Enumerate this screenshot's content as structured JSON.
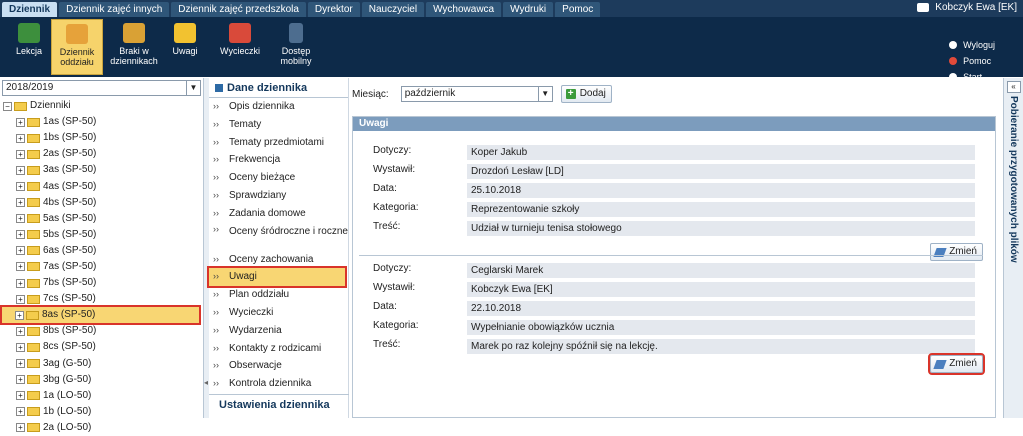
{
  "topbar": {
    "tabs": [
      "Dziennik",
      "Dziennik zajęć innych",
      "Dziennik zajęć przedszkola",
      "Dyrektor",
      "Nauczyciel",
      "Wychowawca",
      "Wydruki",
      "Pomoc"
    ],
    "user": "Kobczyk Ewa [EK]"
  },
  "toolbar": {
    "items": [
      {
        "label": "Lekcja",
        "icon": "chalkboard-icon"
      },
      {
        "label": "Dziennik oddziału",
        "icon": "journal-icon"
      },
      {
        "label": "Braki w dziennikach",
        "icon": "missing-book-icon"
      },
      {
        "label": "Uwagi",
        "icon": "warning-icon"
      },
      {
        "label": "Wycieczki",
        "icon": "backpack-icon"
      },
      {
        "label": "Dostęp mobilny",
        "icon": "mobile-icon"
      }
    ],
    "links": [
      "Wyloguj",
      "Pomoc",
      "Start"
    ]
  },
  "left": {
    "year": "2018/2019",
    "root": "Dzienniki",
    "classes": [
      "1as (SP-50)",
      "1bs (SP-50)",
      "2as (SP-50)",
      "3as (SP-50)",
      "4as (SP-50)",
      "4bs (SP-50)",
      "5as (SP-50)",
      "5bs (SP-50)",
      "6as (SP-50)",
      "7as (SP-50)",
      "7bs (SP-50)",
      "7cs (SP-50)",
      "8as (SP-50)",
      "8bs (SP-50)",
      "8cs (SP-50)",
      "3ag (G-50)",
      "3bg (G-50)",
      "1a (LO-50)",
      "1b (LO-50)",
      "2a (LO-50)"
    ],
    "selected_index": 12
  },
  "menu": {
    "header": "Dane dziennika",
    "items": [
      "Opis dziennika",
      "Tematy",
      "Tematy przedmiotami",
      "Frekwencja",
      "Oceny bieżące",
      "Sprawdziany",
      "Zadania domowe",
      "Oceny śródroczne i roczne",
      "Oceny zachowania",
      "Uwagi",
      "Plan oddziału",
      "Wycieczki",
      "Wydarzenia",
      "Kontakty z rodzicami",
      "Obserwacje",
      "Kontrola dziennika"
    ],
    "selected_index": 9,
    "footer": "Ustawienia dziennika"
  },
  "content": {
    "month_label": "Miesiąc:",
    "month_value": "październik",
    "add_label": "Dodaj",
    "panel_title": "Uwagi",
    "field_labels": [
      "Dotyczy:",
      "Wystawił:",
      "Data:",
      "Kategoria:",
      "Treść:"
    ],
    "edit_label": "Zmień",
    "records": [
      {
        "values": [
          "Koper Jakub",
          "Drozdoń Lesław [LD]",
          "25.10.2018",
          "Reprezentowanie szkoły",
          "Udział w turnieju tenisa stołowego"
        ]
      },
      {
        "values": [
          "Ceglarski Marek",
          "Kobczyk Ewa [EK]",
          "22.10.2018",
          "Wypełnianie obowiązków ucznia",
          "Marek po raz kolejny spóźnił się na lekcję."
        ]
      }
    ]
  },
  "rightbar": {
    "title": "Pobieranie przygotowanych plików"
  }
}
